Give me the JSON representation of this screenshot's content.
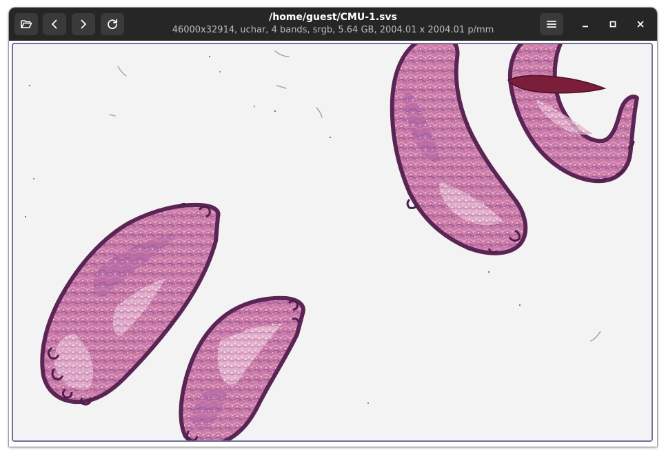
{
  "window": {
    "title": "/home/guest/CMU-1.svs",
    "subtitle": "46000x32914,  uchar, 4 bands, srgb, 5.64 GB, 2004.01 x 2004.01 p/mm"
  },
  "headerbar": {
    "left_buttons": [
      {
        "name": "open-button",
        "icon": "folder-open-icon"
      },
      {
        "name": "back-button",
        "icon": "chevron-left-icon"
      },
      {
        "name": "forward-button",
        "icon": "chevron-right-icon"
      },
      {
        "name": "reload-button",
        "icon": "reload-icon"
      }
    ],
    "menu_button": {
      "icon": "hamburger-menu-icon"
    },
    "window_controls": [
      "minimize-icon",
      "maximize-icon",
      "close-icon"
    ]
  },
  "viewer": {
    "image": "whole-slide tissue image (H&E stained)",
    "colors": {
      "tissue": "#c56f9e",
      "tissue_dark": "#6b2f63",
      "tissue_edge": "#5a2454",
      "background": "#f3f3f3",
      "frame": "#6f6fa0"
    }
  }
}
